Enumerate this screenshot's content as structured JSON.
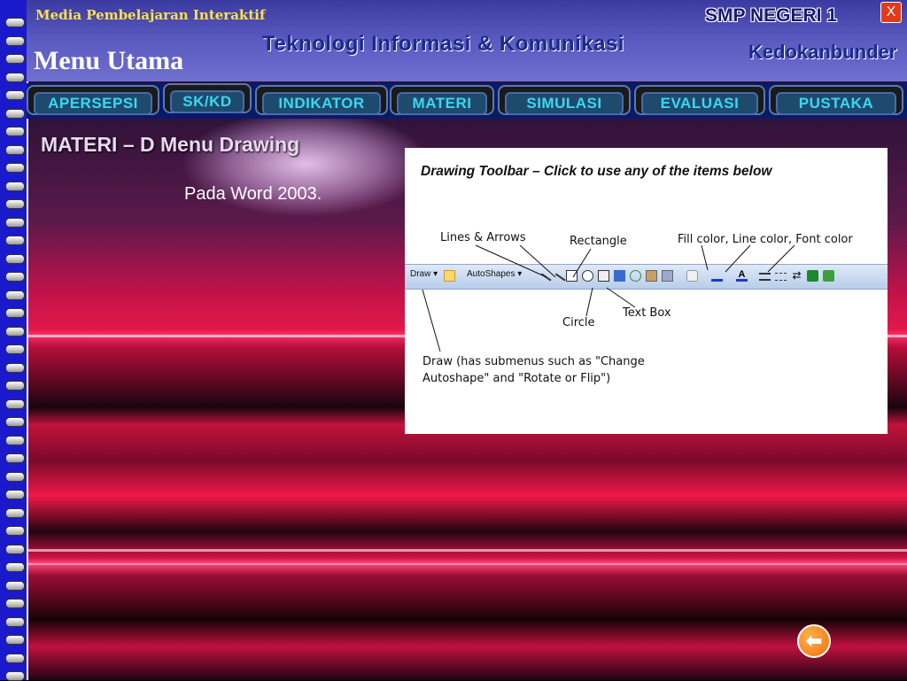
{
  "header": {
    "app_title": "Media Pembelajaran Interaktif",
    "menu_title": "Menu Utama",
    "subject": "Teknologi Informasi & Komunikasi",
    "school": "SMP NEGERI 1",
    "city": "Kedokanbunder",
    "close_label": "X"
  },
  "nav": {
    "items": [
      {
        "label": "APERSEPSI"
      },
      {
        "label": "SK/KD"
      },
      {
        "label": "INDIKATOR"
      },
      {
        "label": "MATERI"
      },
      {
        "label": "SIMULASI"
      },
      {
        "label": "EVALUASI"
      },
      {
        "label": "PUSTAKA"
      }
    ]
  },
  "content": {
    "title": "MATERI – D  Menu Drawing",
    "subtitle": "Pada Word 2003."
  },
  "figure": {
    "heading": "Drawing Toolbar – Click to use any of the items below",
    "labels": {
      "lines_arrows": "Lines & Arrows",
      "rectangle": "Rectangle",
      "fill_color": "Fill color, Line color, Font color",
      "circle": "Circle",
      "text_box": "Text Box",
      "draw_line1": "Draw (has submenus such as \"Change",
      "draw_line2": "Autoshape\" and \"Rotate or Flip\")"
    },
    "toolbar": {
      "draw": "Draw ▾",
      "autoshapes": "AutoShapes ▾"
    }
  },
  "footer": {
    "back_icon": "left-arrow-icon",
    "back_glyph": "⬅"
  },
  "colors": {
    "spiral": "#1a1acc",
    "header": "#5a5ac0",
    "nav_text": "#3ad8f0",
    "title_yellow": "#ffe24a",
    "back_button": "#f07010"
  }
}
